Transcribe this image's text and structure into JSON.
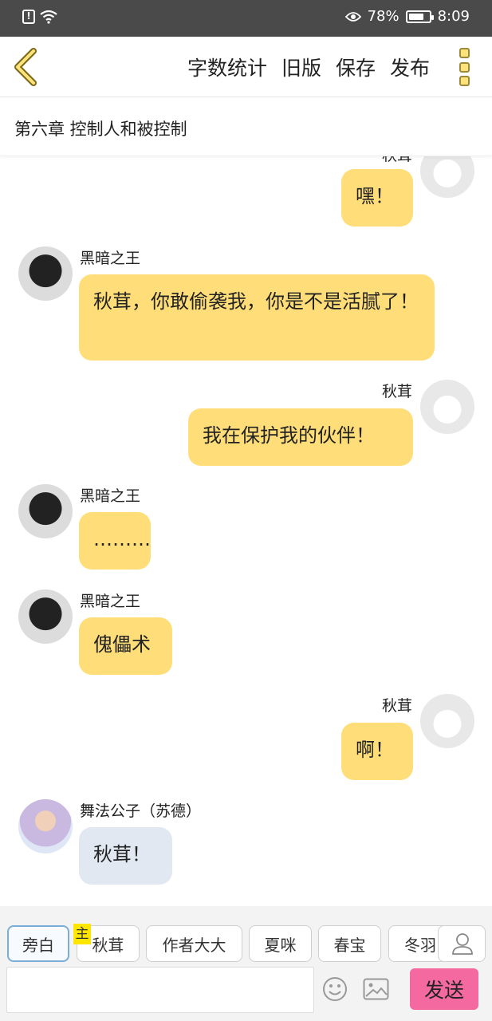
{
  "status_bar": {
    "battery_percent_text": "78%",
    "battery_level": 0.78,
    "time": "8:09"
  },
  "toolbar": {
    "word_count_label": "字数统计",
    "old_version_label": "旧版",
    "save_label": "保存",
    "publish_label": "发布"
  },
  "chapter": {
    "title": "第六章  控制人和被控制"
  },
  "messages": [
    {
      "speaker": "秋茸",
      "side": "right",
      "text": "嘿！"
    },
    {
      "speaker": "黑暗之王",
      "side": "left",
      "text": "秋茸，你敢偷袭我，你是不是活腻了！"
    },
    {
      "speaker": "秋茸",
      "side": "right",
      "text": "我在保护我的伙伴！"
    },
    {
      "speaker": "黑暗之王",
      "side": "left",
      "text": "………"
    },
    {
      "speaker": "黑暗之王",
      "side": "left",
      "text": "傀儡术"
    },
    {
      "speaker": "秋茸",
      "side": "right",
      "text": "啊！"
    },
    {
      "speaker": "舞法公子（苏德）",
      "side": "left",
      "text": "秋茸！"
    }
  ],
  "character_chips": [
    {
      "label": "旁白",
      "active": true
    },
    {
      "label": "秋茸",
      "active": false,
      "badge": "主"
    },
    {
      "label": "作者大大",
      "active": false
    },
    {
      "label": "夏咪",
      "active": false
    },
    {
      "label": "春宝",
      "active": false
    },
    {
      "label": "冬羽",
      "active": false
    }
  ],
  "composer": {
    "input_value": "",
    "send_label": "发送"
  },
  "icons": {
    "back": "chevron-left-icon",
    "more": "more-vertical-icon",
    "person": "person-icon",
    "emoji": "emoji-icon",
    "image": "image-icon"
  },
  "colors": {
    "status_bar": "#4a4a4a",
    "bubble_yellow": "#ffde7a",
    "bubble_blue": "#e2e8f2",
    "send_button": "#f46aa0",
    "main_badge": "#ffe600"
  }
}
